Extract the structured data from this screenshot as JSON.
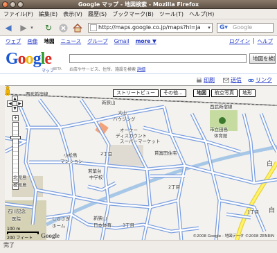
{
  "window": {
    "title": "Google マップ - 地図検索 - Mozilla Firefox"
  },
  "menu": [
    "ファイル(F)",
    "編集(E)",
    "表示(V)",
    "履歴(S)",
    "ブックマーク(B)",
    "ツール(T)",
    "ヘルプ(H)"
  ],
  "nav": {
    "url": "http://maps.google.co.jp/maps?hl=ja",
    "search_placeholder": "Google"
  },
  "google_links": {
    "items": [
      "ウェブ",
      "画像",
      "地図",
      "ニュース",
      "グループ",
      "Gmail",
      "more ▼"
    ],
    "active": "地図",
    "login": "ログイン",
    "help": "ヘルプ"
  },
  "header": {
    "logo_sub": "マップ",
    "logo_beta": "BETA",
    "hint": "お店やサービス、住所、施設を検索",
    "hint_link": "詳細",
    "search_button": "地図を検索"
  },
  "toolbar": {
    "print": "印刷",
    "send": "送信",
    "link": "リンク"
  },
  "map": {
    "types": [
      "地図",
      "航空写真",
      "地形"
    ],
    "active_type": "地図",
    "streetview_label": "ストリートビュー",
    "more_label": "その他...",
    "scale_top": "100 m",
    "scale_bottom": "200 フィート",
    "copyright": "©2008 Google - 地図データ ©2008 ZENRIN",
    "labels": {
      "l1": "西武新宿線",
      "l2": "新狭山",
      "l3": "大山",
      "l4": "ハウジング",
      "l5": "オーケー",
      "l6": "ディスカウント",
      "l7": "スーパーマーケット",
      "l8": "小松島",
      "l9": "マンション",
      "l10": "賃富田住宅",
      "l11": "北児島",
      "l12": "校局島",
      "l13": "若葉台",
      "l14": "中学校",
      "l15": "石川記念",
      "l16": "医院",
      "l17": "しらさぎ",
      "l18": "ホーム",
      "l19": "市立田島",
      "l20": "体育館",
      "l21": "新狭山",
      "l22": "日本体育",
      "l23": "白",
      "l24": "2丁目",
      "l25": "3丁目",
      "l26": "1丁目",
      "l27": "2丁目",
      "l28": "西武新宿線",
      "l29": "白"
    }
  },
  "status": "完了"
}
